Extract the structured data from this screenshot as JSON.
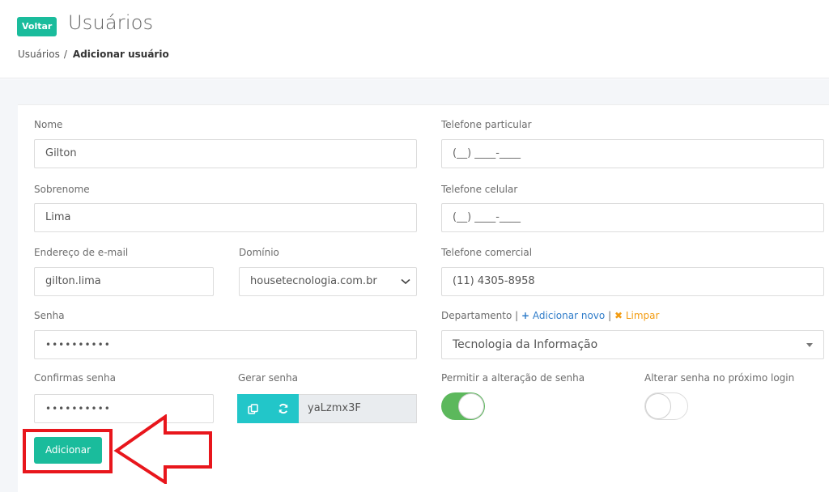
{
  "header": {
    "back_label": "Voltar",
    "title": "Usuários",
    "breadcrumb": {
      "parent": "Usuários",
      "separator": "/",
      "current": "Adicionar usuário"
    }
  },
  "form": {
    "nome": {
      "label": "Nome",
      "value": "Gilton"
    },
    "sobrenome": {
      "label": "Sobrenome",
      "value": "Lima"
    },
    "email": {
      "label": "Endereço de e-mail",
      "value": "gilton.lima"
    },
    "dominio": {
      "label": "Domínio",
      "value": "housetecnologia.com.br"
    },
    "senha": {
      "label": "Senha",
      "value": "••••••••••"
    },
    "confirmar": {
      "label": "Confirmas senha",
      "value": "••••••••••"
    },
    "gerar": {
      "label": "Gerar senha",
      "value": "yaLzmx3F"
    },
    "tel_particular": {
      "label": "Telefone particular",
      "value": "(__) ____-____"
    },
    "tel_celular": {
      "label": "Telefone celular",
      "value": "(__) ____-____"
    },
    "tel_comercial": {
      "label": "Telefone comercial",
      "value": "(11) 4305-8958"
    },
    "departamento": {
      "label": "Departamento",
      "sep": "|",
      "add_label": "Adicionar novo",
      "clear_label": "Limpar",
      "value": "Tecnologia da Informação"
    },
    "permitir": {
      "label": "Permitir a alteração de senha",
      "on": true
    },
    "alterar": {
      "label": "Alterar senha no próximo login",
      "on": false
    },
    "submit_label": "Adicionar"
  },
  "colors": {
    "primary": "#1abc9c",
    "cyan": "#22c6c9",
    "toggle_on": "#5cb85c",
    "highlight": "#e8161c",
    "link_blue": "#2f7cc9",
    "link_orange": "#f39c12"
  },
  "icons": [
    "copy-icon",
    "refresh-icon",
    "chevron-down-icon",
    "caret-down-icon",
    "plus-icon",
    "times-icon",
    "arrow-left-annotation"
  ]
}
